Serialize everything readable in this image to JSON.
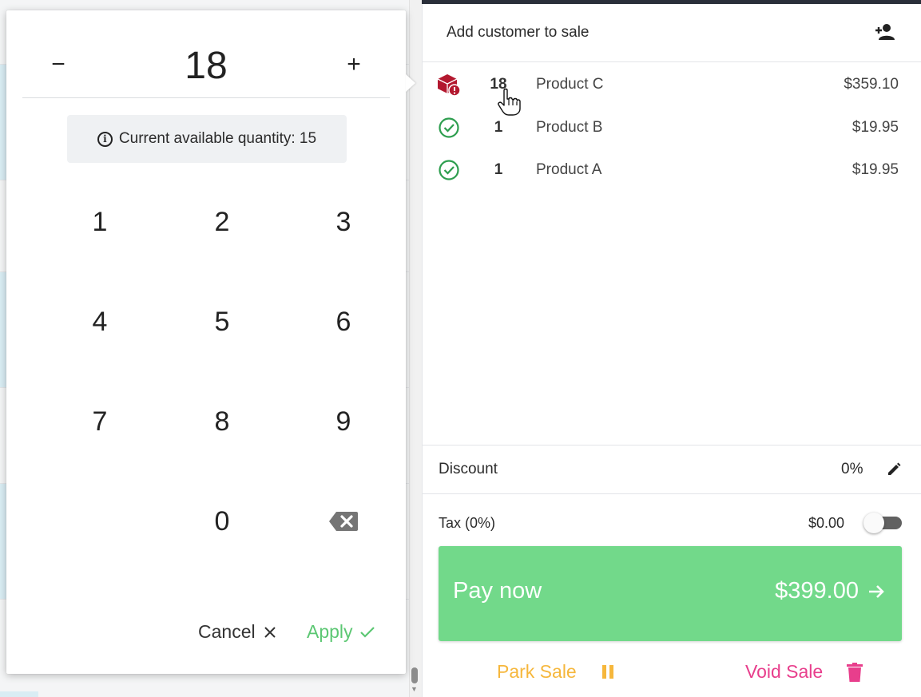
{
  "popup": {
    "quantity": "18",
    "minus_label": "−",
    "plus_label": "+",
    "available_text": "Current available quantity: 15",
    "keys": [
      "1",
      "2",
      "3",
      "4",
      "5",
      "6",
      "7",
      "8",
      "9",
      "0"
    ],
    "cancel_label": "Cancel",
    "apply_label": "Apply"
  },
  "sale": {
    "customer_label": "Add customer to sale",
    "items": [
      {
        "qty": "18",
        "name": "Product C",
        "price": "$359.10",
        "status": "stock-warning"
      },
      {
        "qty": "1",
        "name": "Product B",
        "price": "$19.95",
        "status": "ok"
      },
      {
        "qty": "1",
        "name": "Product A",
        "price": "$19.95",
        "status": "ok"
      }
    ],
    "discount_label": "Discount",
    "discount_value": "0%",
    "tax_label": "Tax (0%)",
    "tax_value": "$0.00",
    "tax_enabled": false,
    "pay_label": "Pay now",
    "pay_amount": "$399.00",
    "park_label": "Park Sale",
    "void_label": "Void Sale"
  },
  "colors": {
    "pay_green": "#72d98a",
    "apply_green": "#5cc773",
    "park_orange": "#f6b73c",
    "void_pink": "#e83e8c",
    "warning_red": "#b3182f",
    "ok_green": "#2e9e4f"
  },
  "icons": {
    "add_customer": "person-add-icon",
    "warning": "box-warning-icon",
    "ok": "check-circle-icon",
    "edit": "pencil-icon",
    "park": "pause-icon",
    "void": "trash-icon",
    "backspace": "backspace-icon",
    "info": "info-icon"
  }
}
